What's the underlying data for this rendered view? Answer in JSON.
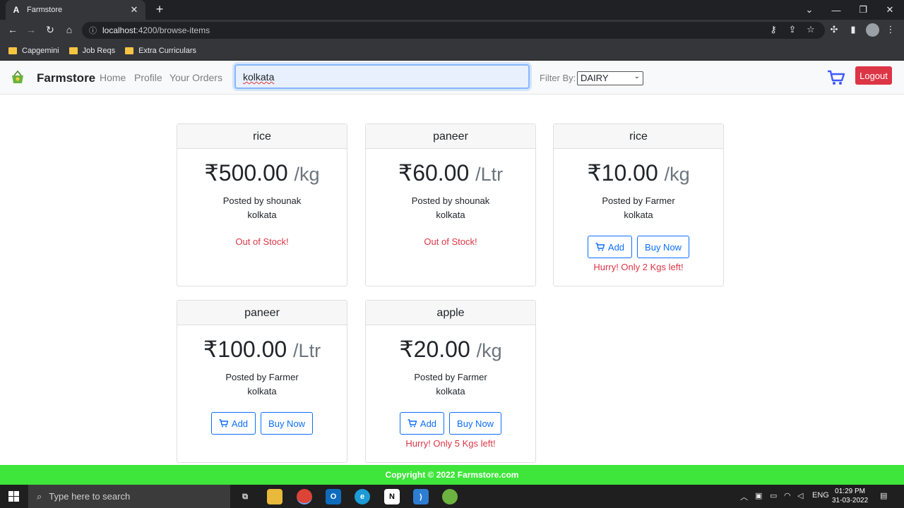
{
  "browser": {
    "tab_title": "Farmstore",
    "tab_favicon": "A",
    "url_host": "localhost",
    "url_rest": ":4200/browse-items",
    "bookmarks": [
      "Capgemini",
      "Job Reqs",
      "Extra Curriculars"
    ]
  },
  "nav": {
    "brand": "Farmstore",
    "links": [
      "Home",
      "Profile",
      "Your Orders"
    ],
    "search_value": "kolkata",
    "filter_label": "Filter By:",
    "filter_value": "DAIRY",
    "logout": "Logout"
  },
  "items": [
    {
      "name": "rice",
      "price": "₹500.00",
      "unit": "/kg",
      "posted_by": "Posted by shounak",
      "location": "kolkata",
      "out_of_stock": "Out of Stock!"
    },
    {
      "name": "paneer",
      "price": "₹60.00",
      "unit": "/Ltr",
      "posted_by": "Posted by shounak",
      "location": "kolkata",
      "out_of_stock": "Out of Stock!"
    },
    {
      "name": "rice",
      "price": "₹10.00",
      "unit": "/kg",
      "posted_by": "Posted by Farmer",
      "location": "kolkata",
      "add": "Add",
      "buy": "Buy Now",
      "hurry": "Hurry! Only 2 Kgs left!"
    },
    {
      "name": "paneer",
      "price": "₹100.00",
      "unit": "/Ltr",
      "posted_by": "Posted by Farmer",
      "location": "kolkata",
      "add": "Add",
      "buy": "Buy Now"
    },
    {
      "name": "apple",
      "price": "₹20.00",
      "unit": "/kg",
      "posted_by": "Posted by Farmer",
      "location": "kolkata",
      "add": "Add",
      "buy": "Buy Now",
      "hurry": "Hurry! Only 5 Kgs left!"
    }
  ],
  "footer": "Copyright © 2022 Farmstore.com",
  "taskbar": {
    "search_placeholder": "Type here to search",
    "lang": "ENG",
    "time": "01:29 PM",
    "date": "31-03-2022"
  },
  "colors": {
    "accent": "#0d6efd",
    "danger": "#dc3545",
    "footer": "#3ee53a"
  }
}
